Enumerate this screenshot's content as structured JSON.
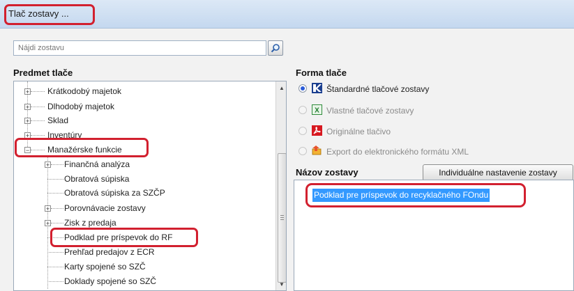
{
  "window": {
    "title": "Tlač zostavy ..."
  },
  "search": {
    "placeholder": "Nájdi zostavu",
    "button_icon": "search-icon"
  },
  "subject": {
    "label": "Predmet tlače",
    "items": [
      {
        "label": "Krátkodobý majetok"
      },
      {
        "label": "Dlhodobý majetok"
      },
      {
        "label": "Sklad"
      },
      {
        "label": "Inventúry"
      },
      {
        "label": "Manažérske funkcie"
      },
      {
        "label": "Finančná analýza"
      },
      {
        "label": "Obratová súpiska"
      },
      {
        "label": "Obratová súpiska za SZČP"
      },
      {
        "label": "Porovnávacie zostavy"
      },
      {
        "label": "Zisk z predaja"
      },
      {
        "label": "Podklad pre príspevok do RF"
      },
      {
        "label": "Prehľad predajov z ECR"
      },
      {
        "label": "Karty spojené so SZČ"
      },
      {
        "label": "Doklady spojené so SZČ"
      }
    ]
  },
  "print_form": {
    "label": "Forma tlače",
    "options": [
      {
        "label": "Štandardné tlačové zostavy",
        "icon": "kros-logo-icon",
        "selected": true,
        "enabled": true
      },
      {
        "label": "Vlastné tlačové zostavy",
        "icon": "excel-icon",
        "selected": false,
        "enabled": false
      },
      {
        "label": "Originálne tlačivo",
        "icon": "pdf-icon",
        "selected": false,
        "enabled": false
      },
      {
        "label": "Export do elektronického formátu XML",
        "icon": "export-icon",
        "selected": false,
        "enabled": false
      }
    ]
  },
  "report_name": {
    "label": "Názov zostavy",
    "settings_button": "Individuálne nastavenie zostavy",
    "selected_value": "Podklad pre príspevok do recyklačného FOndu"
  },
  "highlight_color": "#d2202f",
  "selection_color": "#3399ff"
}
